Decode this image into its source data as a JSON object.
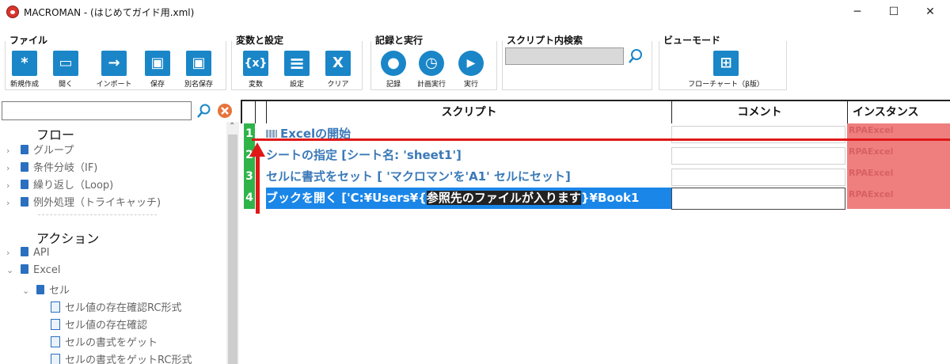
{
  "window": {
    "title": "MACROMAN - (はじめてガイド用.xml)",
    "minimize": "─",
    "maximize": "☐",
    "close": "✕"
  },
  "ribbon": {
    "file": {
      "title": "ファイル",
      "buttons": [
        {
          "label": "新規作成",
          "glyph": "*"
        },
        {
          "label": "開く",
          "glyph": "▭"
        },
        {
          "label": "インポート",
          "glyph": "→"
        },
        {
          "label": "保存",
          "glyph": "▣"
        },
        {
          "label": "別名保存",
          "glyph": "▣"
        }
      ]
    },
    "vars": {
      "title": "変数と設定",
      "buttons": [
        {
          "label": "変数",
          "glyph": "{x}"
        },
        {
          "label": "設定",
          "glyph": "≡"
        },
        {
          "label": "クリア",
          "glyph": "X"
        }
      ]
    },
    "record": {
      "title": "記録と実行",
      "buttons": [
        {
          "label": "記録",
          "glyph": "●"
        },
        {
          "label": "計画実行",
          "glyph": "◷"
        },
        {
          "label": "実行",
          "glyph": "▶"
        }
      ]
    },
    "search": {
      "title": "スクリプト内検索",
      "value": ""
    },
    "view": {
      "title": "ビューモード",
      "button": {
        "label": "フローチャート（β版）",
        "glyph": "⊞"
      }
    }
  },
  "left_panel": {
    "search_value": "",
    "section_flow": "フロー",
    "flow_items": [
      "グループ",
      "条件分岐（IF)",
      "繰り返し（Loop)",
      "例外処理（トライキャッチ)"
    ],
    "section_action": "アクション",
    "action_items": [
      {
        "label": "API",
        "chev": "›"
      },
      {
        "label": "Excel",
        "chev": "⌄"
      },
      {
        "label": "セル",
        "chev": "⌄"
      }
    ],
    "cell_items": [
      "セル値の存在確認RC形式",
      "セル値の存在確認",
      "セルの書式をゲット",
      "セルの書式をゲットRC形式"
    ]
  },
  "grid": {
    "headers": {
      "script": "スクリプト",
      "comment": "コメント",
      "instance": "インスタンス"
    },
    "rows": [
      {
        "num": "1",
        "script": "Excelの開始",
        "instance": "RPAExcel"
      },
      {
        "num": "2",
        "script": "シートの指定 [シート名: 'sheet1']",
        "instance": "RPAExcel"
      },
      {
        "num": "3",
        "script": "セルに書式をセット [ 'マクロマン'を'A1' セルにセット]",
        "instance": "RPAExcel"
      },
      {
        "num": "4",
        "script_pre": "ブックを開く ['C:¥Users¥{",
        "script_hl": "参照先のファイルが入ります",
        "script_post": "}¥Book1",
        "instance": "RPAExcel"
      }
    ]
  },
  "colors": {
    "accent": "#1a86c8",
    "selection": "#1a86e8",
    "row_number": "#2fb44a",
    "instance_bg": "#ef7f7f",
    "annotation": "#e01818"
  }
}
